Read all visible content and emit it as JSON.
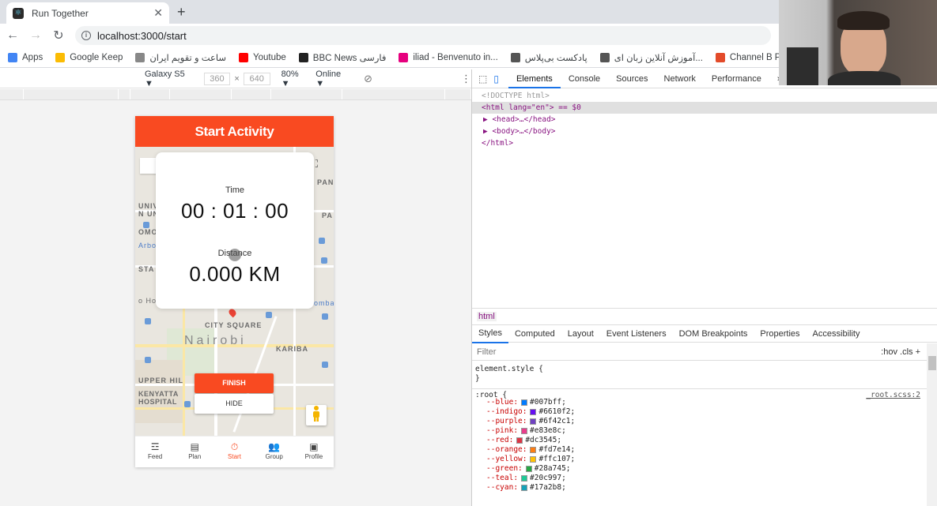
{
  "browser": {
    "tab_title": "Run Together",
    "url": "localhost:3000/start",
    "bookmarks": [
      {
        "label": "Apps",
        "icon": "apps-grid-icon"
      },
      {
        "label": "Google Keep",
        "icon": "keep-icon"
      },
      {
        "label": "ساعت و تقویم ایران",
        "icon": "calendar-icon"
      },
      {
        "label": "Youtube",
        "icon": "youtube-icon"
      },
      {
        "label": "BBC News فارسی",
        "icon": "bbc-icon"
      },
      {
        "label": "iliad - Benvenuto in...",
        "icon": "iliad-icon"
      },
      {
        "label": "پادکست بی‌پلاس",
        "icon": "globe-icon"
      },
      {
        "label": "آموزش آنلاین زبان ای...",
        "icon": "globe-icon"
      },
      {
        "label": "Channel B Podcast...",
        "icon": "podcast-icon"
      }
    ]
  },
  "device_toolbar": {
    "device": "Galaxy S5 ▼",
    "width": "360",
    "height": "640",
    "times": "×",
    "zoom": "80% ▼",
    "network": "Online ▼"
  },
  "app": {
    "header_title": "Start Activity",
    "time_label": "Time",
    "time_value": "00 : 01 : 00",
    "distance_label": "Distance",
    "distance_value": "0.000 KM",
    "finish_label": "FINISH",
    "hide_label": "HIDE",
    "map_labels": [
      "UNIV",
      "N UNI",
      "OMO",
      "Arbo",
      "STA",
      "o Hou",
      "CITY SQUARE",
      "Nairobi",
      "KARIBA",
      "UPPER HIL",
      "KENYATTA",
      "HOSPITAL",
      "PAN",
      "PA",
      "omba"
    ],
    "nav": [
      {
        "label": "Feed",
        "icon": "rss-icon"
      },
      {
        "label": "Plan",
        "icon": "list-icon"
      },
      {
        "label": "Start",
        "icon": "stopwatch-icon"
      },
      {
        "label": "Group",
        "icon": "group-icon"
      },
      {
        "label": "Profile",
        "icon": "profile-icon"
      }
    ]
  },
  "devtools": {
    "tabs": [
      "Elements",
      "Console",
      "Sources",
      "Network",
      "Performance",
      "»"
    ],
    "dom": [
      "<!DOCTYPE html>",
      "<html lang=\"en\"> == $0",
      "▶ <head>…</head>",
      "▶ <body>…</body>",
      "</html>"
    ],
    "breadcrumb": "html",
    "subtabs": [
      "Styles",
      "Computed",
      "Layout",
      "Event Listeners",
      "DOM Breakpoints",
      "Properties",
      "Accessibility"
    ],
    "filter_placeholder": "Filter",
    "filter_tools": ":hov  .cls  +",
    "element_style": "element.style {",
    "close_brace": "}",
    "root_selector": ":root {",
    "root_source": "_root.scss:2",
    "vars": [
      {
        "name": "--blue:",
        "value": "#007bff;",
        "color": "#007bff"
      },
      {
        "name": "--indigo:",
        "value": "#6610f2;",
        "color": "#6610f2"
      },
      {
        "name": "--purple:",
        "value": "#6f42c1;",
        "color": "#6f42c1"
      },
      {
        "name": "--pink:",
        "value": "#e83e8c;",
        "color": "#e83e8c"
      },
      {
        "name": "--red:",
        "value": "#dc3545;",
        "color": "#dc3545"
      },
      {
        "name": "--orange:",
        "value": "#fd7e14;",
        "color": "#fd7e14"
      },
      {
        "name": "--yellow:",
        "value": "#ffc107;",
        "color": "#ffc107"
      },
      {
        "name": "--green:",
        "value": "#28a745;",
        "color": "#28a745"
      },
      {
        "name": "--teal:",
        "value": "#20c997;",
        "color": "#20c997"
      },
      {
        "name": "--cyan:",
        "value": "#17a2b8;",
        "color": "#17a2b8"
      }
    ]
  },
  "colors": {
    "accent": "#f94a21"
  }
}
